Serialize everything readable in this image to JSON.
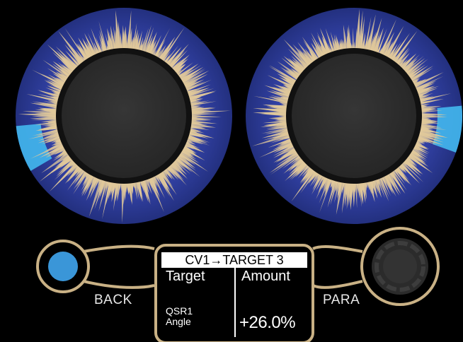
{
  "knobs": [
    {
      "name": "left-knob",
      "value_fraction": 0.62
    },
    {
      "name": "right-knob",
      "value_fraction": 0.2
    }
  ],
  "colors": {
    "ring": "#2d3a9c",
    "ring_dark": "#1e2a7a",
    "spikes": "#e0c89a",
    "indicator": "#43b8ee",
    "knob": "#2e2e2e",
    "panel_outline": "#c9b185",
    "back_button": "#3a96d8"
  },
  "controls": {
    "back_label": "BACK",
    "para_label": "PARA"
  },
  "display": {
    "title": "CV1→TARGET 3",
    "col_target": "Target",
    "col_amount": "Amount",
    "target_line1": "QSR1",
    "target_line2": "Angle",
    "amount_value": "+26.0%"
  }
}
